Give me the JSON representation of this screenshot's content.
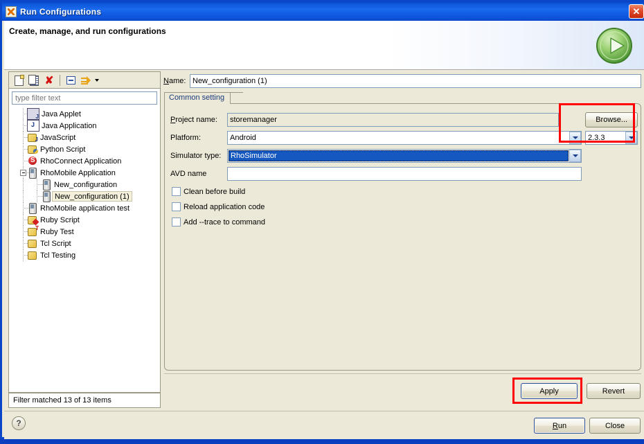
{
  "window": {
    "title": "Run Configurations",
    "app_icon": "rhomobile-icon",
    "close_label": "✕"
  },
  "header": {
    "title": "Create, manage, and run configurations",
    "icon": "run-green-play-icon"
  },
  "colors": {
    "titlebar_blue": "#1360E6",
    "panel_bg": "#ECE9D8",
    "field_border": "#7F9DB9",
    "selection_blue": "#1558C0",
    "annotation_red": "#FF0000",
    "accent_green": "#6AB04A"
  },
  "tree_toolbar": {
    "buttons": [
      {
        "name": "new-configuration-button",
        "icon": "new-document-icon",
        "tooltip": "New launch configuration"
      },
      {
        "name": "duplicate-configuration-button",
        "icon": "duplicate-icon",
        "tooltip": "Duplicate"
      },
      {
        "name": "delete-configuration-button",
        "icon": "delete-red-x-icon",
        "tooltip": "Delete"
      },
      {
        "name": "collapse-all-button",
        "icon": "collapse-all-icon",
        "tooltip": "Collapse All"
      },
      {
        "name": "filter-button",
        "icon": "filter-arrows-icon",
        "tooltip": "Filter"
      }
    ]
  },
  "filter": {
    "placeholder": "type filter text",
    "value": ""
  },
  "tree": {
    "items": [
      {
        "label": "Java Applet",
        "icon": "java-applet-icon",
        "level": 1,
        "expandable": false,
        "selected": false
      },
      {
        "label": "Java Application",
        "icon": "java-app-icon",
        "level": 1,
        "expandable": false,
        "selected": false
      },
      {
        "label": "JavaScript",
        "icon": "javascript-icon",
        "level": 1,
        "expandable": false,
        "selected": false
      },
      {
        "label": "Python Script",
        "icon": "python-script-icon",
        "level": 1,
        "expandable": false,
        "selected": false
      },
      {
        "label": "RhoConnect Application",
        "icon": "rhoconnect-icon",
        "level": 1,
        "expandable": false,
        "selected": false
      },
      {
        "label": "RhoMobile Application",
        "icon": "rhomobile-icon",
        "level": 1,
        "expandable": true,
        "selected": false
      },
      {
        "label": "New_configuration",
        "icon": "rhomobile-icon",
        "level": 2,
        "expandable": false,
        "selected": false
      },
      {
        "label": "New_configuration (1)",
        "icon": "rhomobile-icon",
        "level": 2,
        "expandable": false,
        "selected": true
      },
      {
        "label": "RhoMobile application test",
        "icon": "rhomobile-icon",
        "level": 1,
        "expandable": false,
        "selected": false
      },
      {
        "label": "Ruby Script",
        "icon": "ruby-script-icon",
        "level": 1,
        "expandable": false,
        "selected": false
      },
      {
        "label": "Ruby Test",
        "icon": "ruby-test-icon",
        "level": 1,
        "expandable": false,
        "selected": false
      },
      {
        "label": "Tcl Script",
        "icon": "tcl-script-icon",
        "level": 1,
        "expandable": false,
        "selected": false
      },
      {
        "label": "Tcl Testing",
        "icon": "tcl-testing-icon",
        "level": 1,
        "expandable": false,
        "selected": false
      }
    ],
    "status": "Filter matched 13 of 13 items"
  },
  "form": {
    "name_label": "Name:",
    "name_value": "New_configuration (1)",
    "tab_label": "Common setting",
    "project_name_label": "Project name:",
    "project_name_value": "storemanager",
    "browse_label": "Browse...",
    "platform_label": "Platform:",
    "platform_value": "Android",
    "platform_version_value": "2.3.3",
    "simulator_type_label": "Simulator type:",
    "simulator_type_value": "RhoSimulator",
    "avd_name_label": "AVD name",
    "avd_name_value": "",
    "checkboxes": [
      {
        "label": "Clean before build",
        "checked": false
      },
      {
        "label": "Reload application code",
        "checked": false
      },
      {
        "label": "Add --trace to command",
        "checked": false
      }
    ],
    "apply_label": "Apply",
    "revert_label": "Revert"
  },
  "footer": {
    "help_label": "?",
    "run_label": "Run",
    "close_label": "Close"
  },
  "annotations": [
    {
      "name": "platform-version-highlight",
      "shape": "rectangle",
      "color": "#FF0000"
    },
    {
      "name": "apply-button-highlight",
      "shape": "rectangle",
      "color": "#FF0000"
    }
  ]
}
